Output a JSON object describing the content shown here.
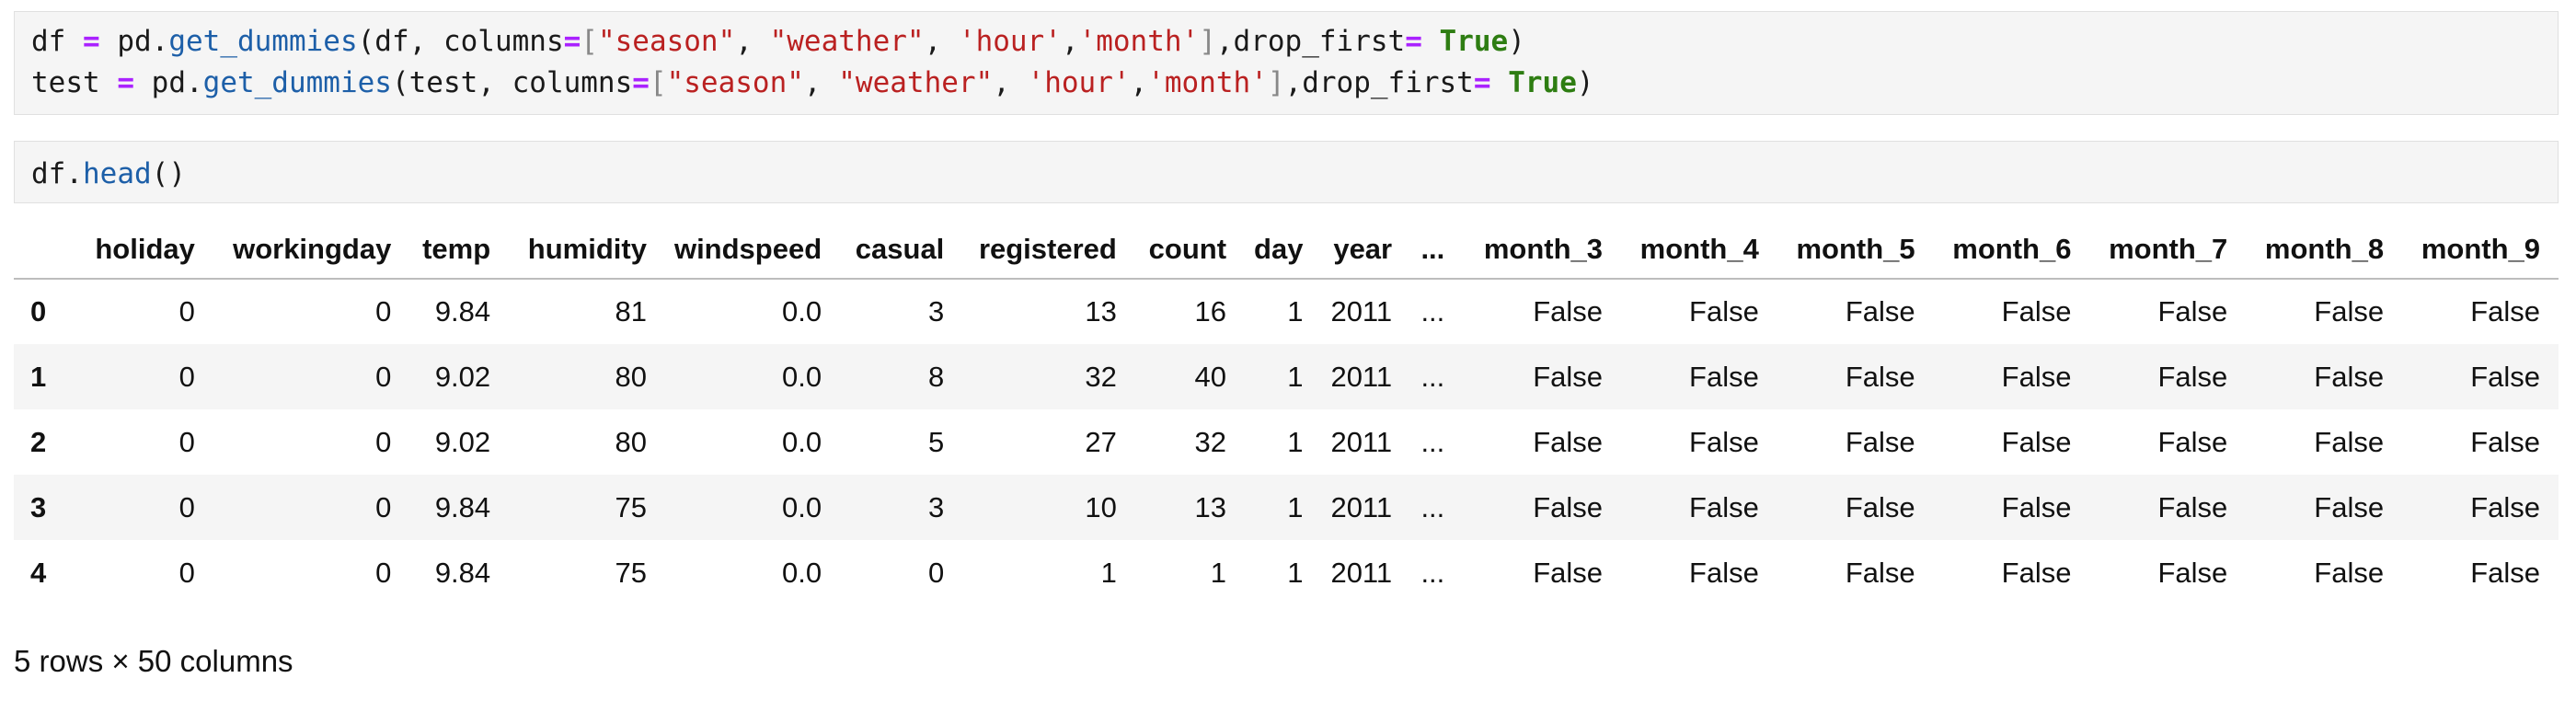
{
  "cell1": {
    "line1": {
      "t0": "df ",
      "t1": "=",
      "t2": " pd.",
      "t3": "get_dummies",
      "t4": "(df, columns",
      "t5": "=",
      "t6": "[",
      "t7": "\"season\"",
      "t8": ", ",
      "t9": "\"weather\"",
      "t10": ", ",
      "t11": "'hour'",
      "t12": ",",
      "t13": "'month'",
      "t14": "]",
      "t15": ",drop_first",
      "t16": "=",
      "t17": " ",
      "t18": "True",
      "t19": ")"
    },
    "line2": {
      "t0": "test ",
      "t1": "=",
      "t2": " pd.",
      "t3": "get_dummies",
      "t4": "(test, columns",
      "t5": "=",
      "t6": "[",
      "t7": "\"season\"",
      "t8": ", ",
      "t9": "\"weather\"",
      "t10": ", ",
      "t11": "'hour'",
      "t12": ",",
      "t13": "'month'",
      "t14": "]",
      "t15": ",drop_first",
      "t16": "=",
      "t17": " ",
      "t18": "True",
      "t19": ")"
    }
  },
  "cell2": {
    "t0": "df.",
    "t1": "head",
    "t2": "()"
  },
  "table": {
    "columns": [
      "",
      "holiday",
      "workingday",
      "temp",
      "humidity",
      "windspeed",
      "casual",
      "registered",
      "count",
      "day",
      "year",
      "...",
      "month_3",
      "month_4",
      "month_5",
      "month_6",
      "month_7",
      "month_8",
      "month_9"
    ],
    "rows": [
      [
        "0",
        "0",
        "0",
        "9.84",
        "81",
        "0.0",
        "3",
        "13",
        "16",
        "1",
        "2011",
        "...",
        "False",
        "False",
        "False",
        "False",
        "False",
        "False",
        "False"
      ],
      [
        "1",
        "0",
        "0",
        "9.02",
        "80",
        "0.0",
        "8",
        "32",
        "40",
        "1",
        "2011",
        "...",
        "False",
        "False",
        "False",
        "False",
        "False",
        "False",
        "False"
      ],
      [
        "2",
        "0",
        "0",
        "9.02",
        "80",
        "0.0",
        "5",
        "27",
        "32",
        "1",
        "2011",
        "...",
        "False",
        "False",
        "False",
        "False",
        "False",
        "False",
        "False"
      ],
      [
        "3",
        "0",
        "0",
        "9.84",
        "75",
        "0.0",
        "3",
        "10",
        "13",
        "1",
        "2011",
        "...",
        "False",
        "False",
        "False",
        "False",
        "False",
        "False",
        "False"
      ],
      [
        "4",
        "0",
        "0",
        "9.84",
        "75",
        "0.0",
        "0",
        "1",
        "1",
        "1",
        "2011",
        "...",
        "False",
        "False",
        "False",
        "False",
        "False",
        "False",
        "False"
      ]
    ]
  },
  "summary": "5 rows × 50 columns"
}
